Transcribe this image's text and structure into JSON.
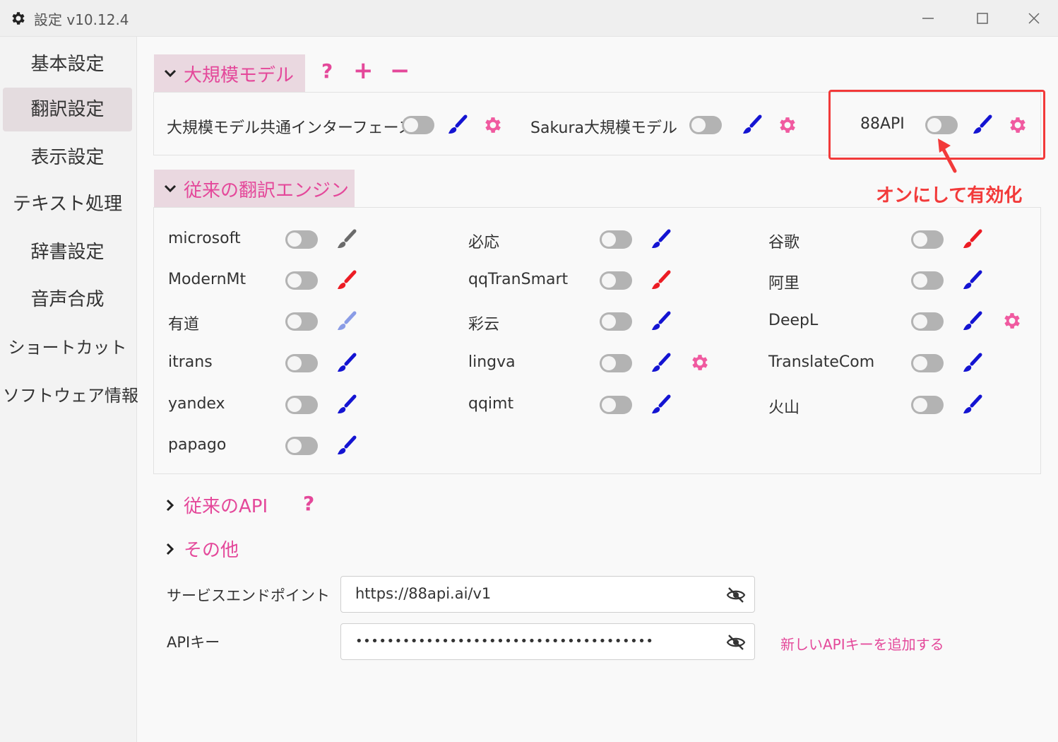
{
  "window": {
    "title": "設定 v10.12.4"
  },
  "sidebar": {
    "items": [
      {
        "label": "基本設定"
      },
      {
        "label": "翻訳設定",
        "active": true
      },
      {
        "label": "表示設定"
      },
      {
        "label": "テキスト処理"
      },
      {
        "label": "辞書設定"
      },
      {
        "label": "音声合成"
      },
      {
        "label": "ショートカット"
      },
      {
        "label": "ソフトウェア情報"
      }
    ]
  },
  "llm_section": {
    "title": "大規模モデル",
    "help": "?",
    "add": "+",
    "remove": "−",
    "items": [
      {
        "label": "大規模モデル共通インターフェース",
        "enabled": false,
        "brush_color": "#1414d2",
        "has_settings": true
      },
      {
        "label": "Sakura大規模モデル",
        "enabled": false,
        "brush_color": "#1414d2",
        "has_settings": true
      },
      {
        "label": "88API",
        "enabled": false,
        "brush_color": "#1414d2",
        "has_settings": true
      }
    ]
  },
  "annotation": {
    "text": "オンにして有効化"
  },
  "traditional_section": {
    "title": "従来の翻訳エンジン",
    "rows": [
      [
        {
          "label": "microsoft",
          "enabled": false,
          "brush_color": "#6b6b6b"
        },
        {
          "label": "必応",
          "enabled": false,
          "brush_color": "#1414d2"
        },
        {
          "label": "谷歌",
          "enabled": false,
          "brush_color": "#ec1c24"
        }
      ],
      [
        {
          "label": "ModernMt",
          "enabled": false,
          "brush_color": "#ec1c24"
        },
        {
          "label": "qqTranSmart",
          "enabled": false,
          "brush_color": "#ec1c24"
        },
        {
          "label": "阿里",
          "enabled": false,
          "brush_color": "#1414d2"
        }
      ],
      [
        {
          "label": "有道",
          "enabled": false,
          "brush_color": "#8a9ce6"
        },
        {
          "label": "彩云",
          "enabled": false,
          "brush_color": "#1414d2"
        },
        {
          "label": "DeepL",
          "enabled": false,
          "brush_color": "#1414d2",
          "has_settings": true
        }
      ],
      [
        {
          "label": "itrans",
          "enabled": false,
          "brush_color": "#1414d2"
        },
        {
          "label": "lingva",
          "enabled": false,
          "brush_color": "#1414d2",
          "has_settings": true
        },
        {
          "label": "TranslateCom",
          "enabled": false,
          "brush_color": "#1414d2"
        }
      ],
      [
        {
          "label": "yandex",
          "enabled": false,
          "brush_color": "#1414d2"
        },
        {
          "label": "qqimt",
          "enabled": false,
          "brush_color": "#1414d2"
        },
        {
          "label": "火山",
          "enabled": false,
          "brush_color": "#1414d2"
        }
      ],
      [
        {
          "label": "papago",
          "enabled": false,
          "brush_color": "#1414d2"
        }
      ]
    ]
  },
  "api_section": {
    "title": "従来のAPI",
    "help": "?"
  },
  "other_section": {
    "title": "その他"
  },
  "endpoint": {
    "label": "サービスエンドポイント",
    "value": "https://88api.ai/v1"
  },
  "apikey": {
    "label": "APIキー",
    "value": "••••••••••••••••••••••••••••••••••••••",
    "link": "新しいAPIキーを追加する"
  },
  "colors": {
    "accent_pink": "#e4489a",
    "annotation_red": "#f23a3a",
    "brush_blue": "#1414d2",
    "brush_red": "#ec1c24"
  }
}
